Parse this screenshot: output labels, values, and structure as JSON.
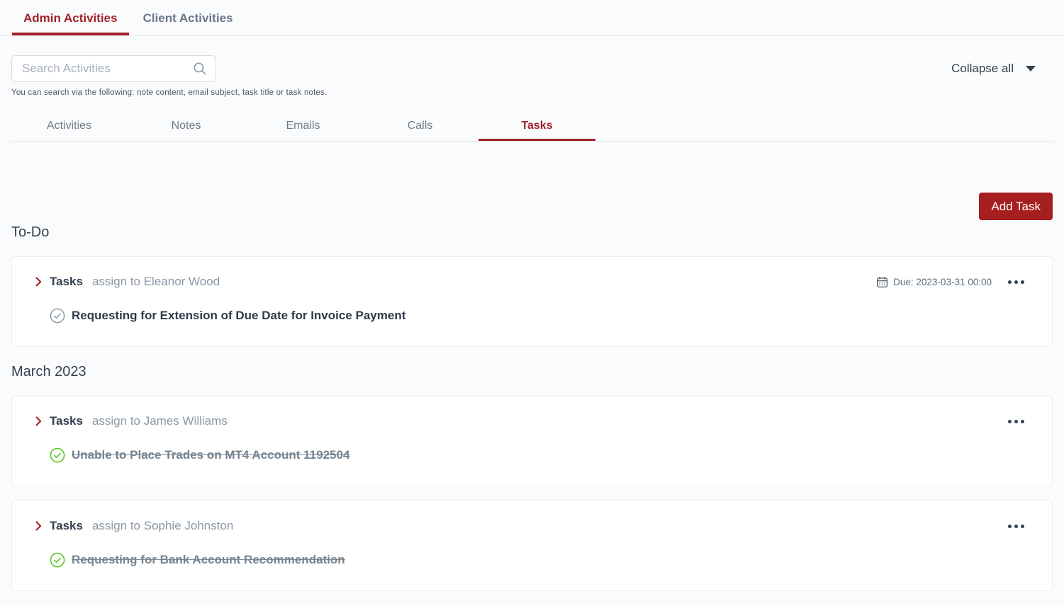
{
  "header_tabs": {
    "admin": {
      "label": "Admin Activities",
      "active": true
    },
    "client": {
      "label": "Client Activities",
      "active": false
    }
  },
  "search": {
    "placeholder": "Search Activities",
    "hint": "You can search via the following: note content, email subject, task title or task notes."
  },
  "toolbar": {
    "collapse_label": "Collapse all",
    "add_task_label": "Add Task"
  },
  "activity_tabs": {
    "activities": {
      "label": "Activities",
      "active": false
    },
    "notes": {
      "label": "Notes",
      "active": false
    },
    "emails": {
      "label": "Emails",
      "active": false
    },
    "calls": {
      "label": "Calls",
      "active": false
    },
    "tasks": {
      "label": "Tasks",
      "active": true
    }
  },
  "sections": [
    {
      "title": "To-Do",
      "cards": [
        {
          "type_label": "Tasks",
          "assignee_text": "assign to Eleanor Wood",
          "due_text": "Due: 2023-03-31 00:00",
          "task_title": "Requesting for Extension of Due Date for Invoice Payment",
          "completed": false
        }
      ]
    },
    {
      "title": "March 2023",
      "cards": [
        {
          "type_label": "Tasks",
          "assignee_text": "assign to James Williams",
          "task_title": "Unable to Place Trades on MT4 Account 1192504",
          "completed": true
        },
        {
          "type_label": "Tasks",
          "assignee_text": "assign to Sophie Johnston",
          "task_title": "Requesting for Bank Account Recommendation",
          "completed": true
        }
      ]
    }
  ],
  "colors": {
    "accent_red": "#A3222A",
    "button_red": "#A51F1F",
    "success_green": "#52C41A",
    "incomplete_gray": "#8C9BAB",
    "text_dark": "#333F50",
    "text_muted": "#8A97A6",
    "page_background": "#FAFBFC"
  },
  "icons": {
    "search": "magnifier",
    "collapse_caret": "triangle-down",
    "expander": "chevron-right",
    "task_incomplete": "circle-check-outline-gray",
    "task_complete": "circle-check-outline-green",
    "due_date": "calendar",
    "more": "horizontal-ellipsis"
  }
}
